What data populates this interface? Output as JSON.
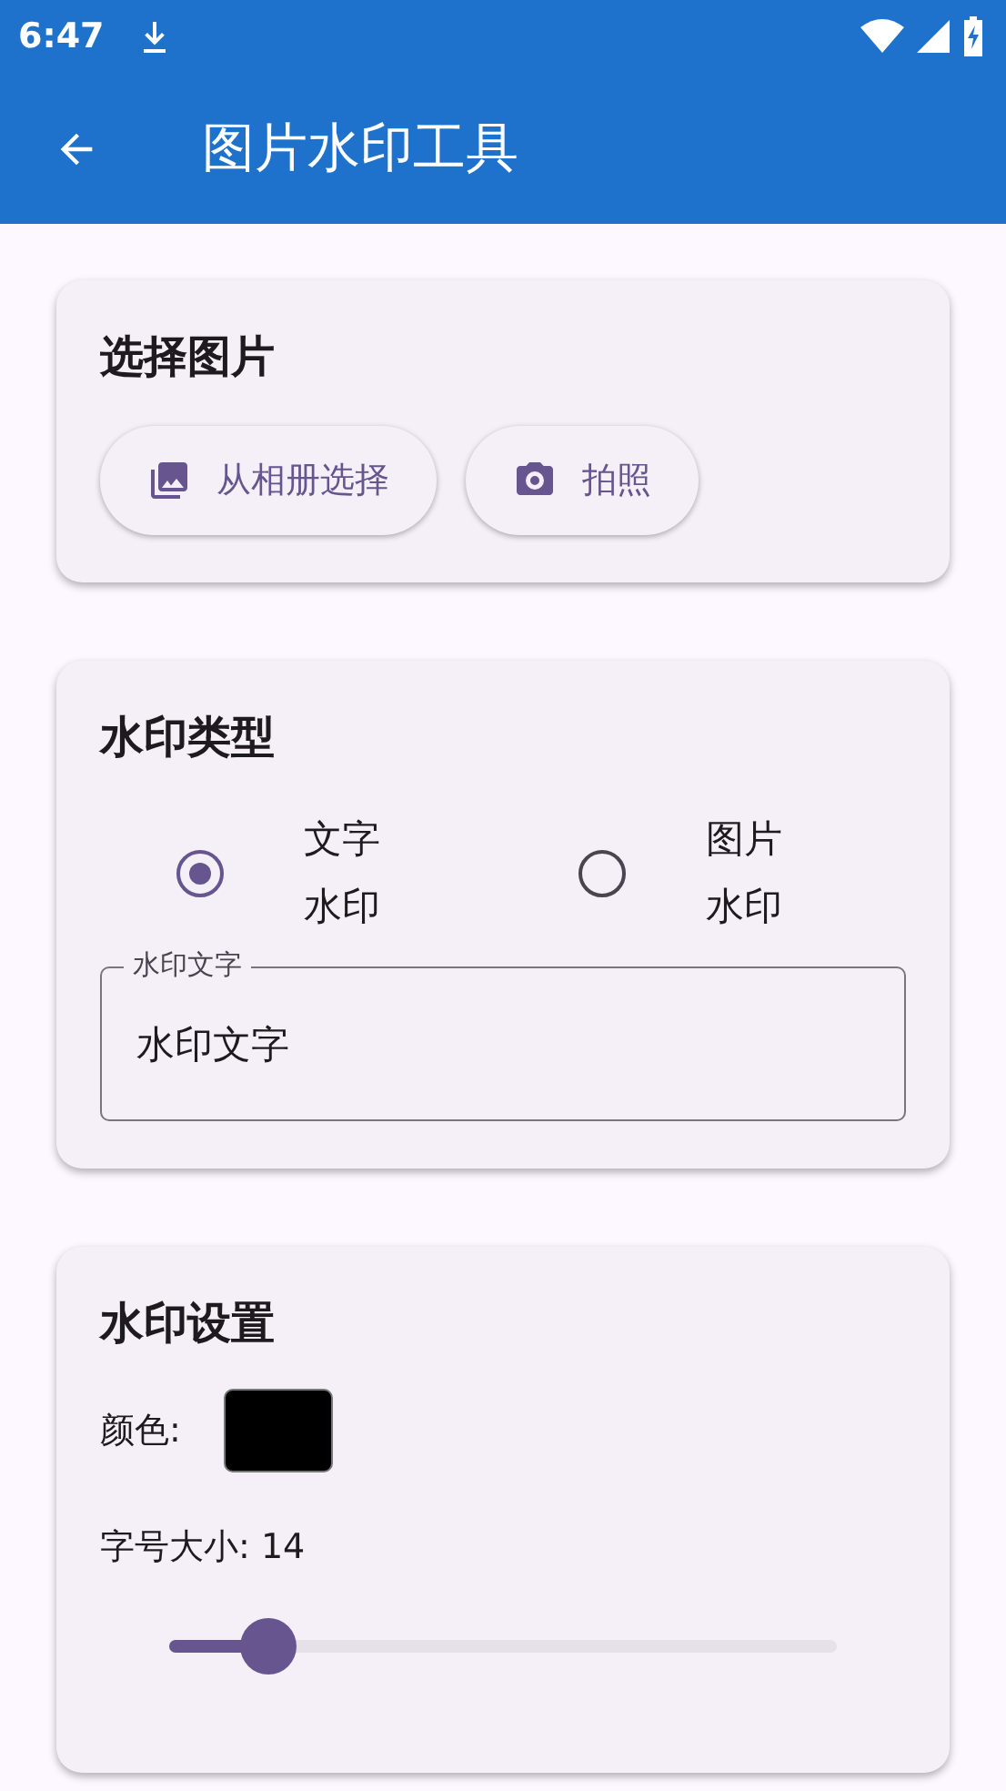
{
  "status_bar": {
    "time": "6:47"
  },
  "app_bar": {
    "title": "图片水印工具"
  },
  "select_card": {
    "title": "选择图片",
    "buttons": [
      {
        "label": "从相册选择",
        "kind": "gallery"
      },
      {
        "label": "拍照",
        "kind": "camera"
      }
    ]
  },
  "type_card": {
    "title": "水印类型",
    "options": [
      {
        "label": "文字水印",
        "selected": true
      },
      {
        "label": "图片水印",
        "selected": false
      }
    ],
    "field": {
      "label": "水印文字",
      "value": "水印文字"
    }
  },
  "settings_card": {
    "title": "水印设置",
    "color_label": "颜色:",
    "color": "#000000",
    "size_label": "字号大小: 14",
    "size_slider": {
      "level": 0.15
    }
  }
}
